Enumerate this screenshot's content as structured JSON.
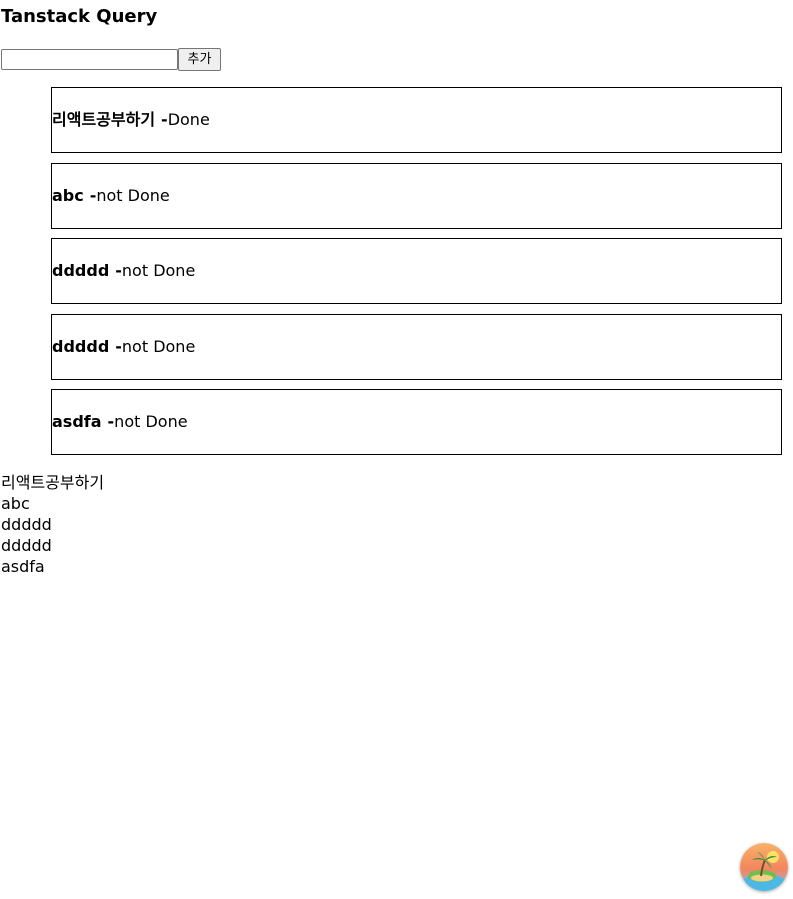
{
  "page": {
    "title": "Tanstack Query"
  },
  "form": {
    "input_value": "",
    "add_label": "추가"
  },
  "todos": [
    {
      "name": "리액트공부하기",
      "separator": "-",
      "status": "Done"
    },
    {
      "name": "abc",
      "separator": "-",
      "status": "not Done"
    },
    {
      "name": "ddddd",
      "separator": "-",
      "status": "not Done"
    },
    {
      "name": "ddddd",
      "separator": "-",
      "status": "not Done"
    },
    {
      "name": "asdfa",
      "separator": "-",
      "status": "not Done"
    }
  ],
  "plain_list": [
    "리액트공부하기",
    "abc",
    "ddddd",
    "ddddd",
    "asdfa"
  ],
  "floating_button": {
    "icon": "tropical-island-icon"
  },
  "colors": {
    "border": "#000000",
    "button_bg": "#efefef",
    "input_border": "#767676"
  }
}
